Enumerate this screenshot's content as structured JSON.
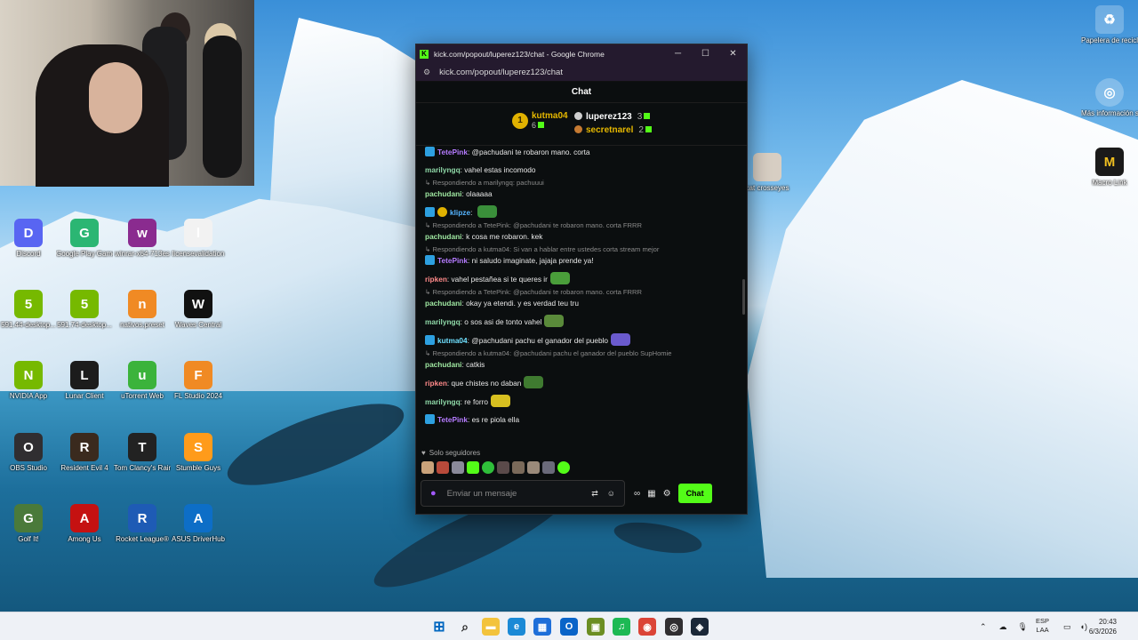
{
  "colors": {
    "accent": "#53fc18",
    "gold": "#e6b800",
    "chat_bg": "#0b0e0f"
  },
  "desktop_icons": [
    {
      "label": "Discord",
      "icon": "discord-icon",
      "color": "#5865f2"
    },
    {
      "label": "Google Play Games",
      "icon": "google-play-games-icon",
      "color": "#2bb673"
    },
    {
      "label": "winrar-x64-713es",
      "icon": "winrar-icon",
      "color": "#8a2b8f"
    },
    {
      "label": "licensevalidation",
      "icon": "document-icon",
      "color": "#f2f2f2"
    },
    {
      "label": "591.44-desktop...",
      "icon": "nvidia-icon",
      "color": "#76b900"
    },
    {
      "label": "591.74-desktop...",
      "icon": "nvidia-icon",
      "color": "#76b900"
    },
    {
      "label": "nativos.preset",
      "icon": "fl-studio-icon",
      "color": "#f08a24"
    },
    {
      "label": "Waves Central",
      "icon": "waves-icon",
      "color": "#111111"
    },
    {
      "label": "NVIDIA App",
      "icon": "nvidia-icon",
      "color": "#76b900"
    },
    {
      "label": "Lunar Client",
      "icon": "lunar-client-icon",
      "color": "#1c1c1c"
    },
    {
      "label": "uTorrent Web",
      "icon": "utorrent-icon",
      "color": "#3bb33b"
    },
    {
      "label": "FL Studio 2024",
      "icon": "fl-studio-icon",
      "color": "#f08a24"
    },
    {
      "label": "OBS Studio",
      "icon": "obs-icon",
      "color": "#302e31"
    },
    {
      "label": "Resident Evil 4",
      "icon": "game-icon",
      "color": "#3a2a1e"
    },
    {
      "label": "Tom Clancy's Rainbow Six...",
      "icon": "rainbow-six-icon",
      "color": "#222222"
    },
    {
      "label": "Stumble Guys",
      "icon": "stumble-guys-icon",
      "color": "#ff9b1a"
    },
    {
      "label": "Golf It!",
      "icon": "golf-icon",
      "color": "#4a7a3a"
    },
    {
      "label": "Among Us",
      "icon": "among-us-icon",
      "color": "#c51111"
    },
    {
      "label": "Rocket League®",
      "icon": "rocket-league-icon",
      "color": "#1e5bb5"
    },
    {
      "label": "ASUS DriverHub",
      "icon": "asus-icon",
      "color": "#0d6ec7"
    }
  ],
  "right_icons": [
    {
      "label": "Papelera de reciclaje",
      "icon": "recycle-bin-icon"
    },
    {
      "label": "Más información sobre esta ima...",
      "icon": "info-icon"
    },
    {
      "label": "cat crosseyes",
      "icon": "image-icon"
    },
    {
      "label": "Macro Link",
      "icon": "macro-link-icon"
    }
  ],
  "browser": {
    "title": "kick.com/popout/luperez123/chat - Google Chrome",
    "url": "kick.com/popout/luperez123/chat",
    "minimize": "─",
    "maximize": "☐",
    "close": "✕"
  },
  "chat": {
    "header": "Chat",
    "leader1": {
      "name": "kutma04",
      "count": "6"
    },
    "leader2": {
      "name": "luperez123",
      "count": "3"
    },
    "leader3": {
      "name": "secretnarel",
      "count": "2"
    },
    "messages": [
      {
        "type": "msg",
        "user": "TetePink",
        "color": "#b57bff",
        "badge": "sub",
        "text": "@pachudani te robaron mano. corta"
      },
      {
        "type": "msg",
        "user": "marilyngq",
        "color": "#8fd9a8",
        "badge": "",
        "text": "vahel estas incomodo"
      },
      {
        "type": "reply",
        "text": "Respondiendo a marilyngq: pachuuui"
      },
      {
        "type": "msg",
        "user": "pachudani",
        "color": "#9ee6a0",
        "badge": "",
        "text": "olaaaaa",
        "cont": true
      },
      {
        "type": "msg",
        "user": "klipze",
        "color": "#55b4ff",
        "badge": "sub1",
        "text": "",
        "emote": "#3a8f3a"
      },
      {
        "type": "reply",
        "text": "Respondiendo a TetePink: @pachudani te robaron mano. corta FRRR"
      },
      {
        "type": "msg",
        "user": "pachudani",
        "color": "#9ee6a0",
        "badge": "",
        "text": "k cosa me robaron. kek",
        "cont": true
      },
      {
        "type": "reply",
        "text": "Respondiendo a kutma04: Si van a hablar entre ustedes corta stream mejor"
      },
      {
        "type": "msg",
        "user": "TetePink",
        "color": "#b57bff",
        "badge": "sub",
        "text": "ni saludo imaginate, jajaja prende ya!",
        "cont": true
      },
      {
        "type": "msg",
        "user": "ripken",
        "color": "#ff8a8a",
        "badge": "",
        "text": "vahel pestañea si te queres ir",
        "emote": "#4a9e3a"
      },
      {
        "type": "reply",
        "text": "Respondiendo a TetePink: @pachudani te robaron mano. corta FRRR"
      },
      {
        "type": "msg",
        "user": "pachudani",
        "color": "#9ee6a0",
        "badge": "",
        "text": "okay ya etendi. y es verdad teu tru",
        "cont": true
      },
      {
        "type": "msg",
        "user": "marilyngq",
        "color": "#8fd9a8",
        "badge": "",
        "text": "o sos asi de tonto vahel",
        "emote": "#5a8a3a"
      },
      {
        "type": "msg",
        "user": "kutma04",
        "color": "#6fe0ff",
        "badge": "sub",
        "text": "@pachudani pachu el ganador del pueblo",
        "emote": "#6a5acd"
      },
      {
        "type": "reply",
        "text": "Respondiendo a kutma04: @pachudani pachu el ganador del pueblo SupHomie"
      },
      {
        "type": "msg",
        "user": "pachudani",
        "color": "#9ee6a0",
        "badge": "",
        "text": "catkis",
        "cont": true
      },
      {
        "type": "msg",
        "user": "ripken",
        "color": "#ff8a8a",
        "badge": "",
        "text": "que chistes no daban",
        "emote": "#3f7a30"
      },
      {
        "type": "msg",
        "user": "marilyngq",
        "color": "#8fd9a8",
        "badge": "",
        "text": "re forro",
        "emote": "#d8c020"
      },
      {
        "type": "msg",
        "user": "TetePink",
        "color": "#b57bff",
        "badge": "sub",
        "text": "es re piola ella"
      }
    ],
    "followers_label": "Solo seguidores",
    "input_placeholder": "Enviar un mensaje",
    "send_label": "Chat"
  },
  "taskbar": {
    "icons": [
      "windows-start-icon",
      "search-icon",
      "file-explorer-icon",
      "edge-icon",
      "microsoft-store-icon",
      "outlook-icon",
      "minecraft-icon",
      "spotify-icon",
      "chrome-icon",
      "obs-icon",
      "steam-icon"
    ],
    "lang_top": "ESP",
    "lang_bottom": "LAA",
    "time": "20:43",
    "date": "6/3/2026"
  }
}
